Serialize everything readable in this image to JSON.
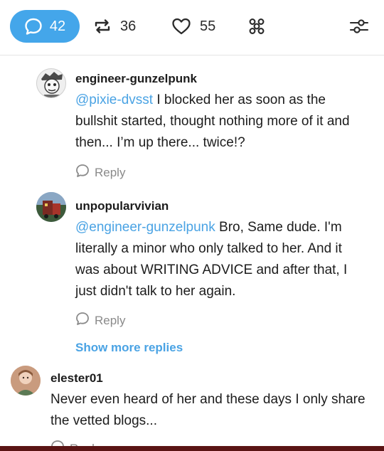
{
  "stats": {
    "comments": "42",
    "reblogs": "36",
    "likes": "55"
  },
  "icons": {
    "comments": "speech-bubble-icon",
    "reblogs": "reblog-icon",
    "likes": "heart-icon",
    "grid": "apps-icon",
    "filter": "sliders-icon",
    "reply": "speech-bubble-icon"
  },
  "colors": {
    "accent": "#44a6ea",
    "mention": "#4aa3e4"
  },
  "comments": [
    {
      "username": "engineer-gunzelpunk",
      "mention": "@pixie-dvsst",
      "text": " I blocked her as soon as the bullshit started, thought nothing more of it and then... I’m up there... twice!?",
      "reply_label": "Reply"
    },
    {
      "username": "unpopularvivian",
      "mention": "@engineer-gunzelpunk",
      "text": " Bro, Same dude. I'm literally a minor who only talked to her. And it was about WRITING ADVICE and after that, I just didn't talk to her again.",
      "reply_label": "Reply"
    },
    {
      "username": "elester01",
      "mention": "",
      "text": "Never even heard of her and these days I only share the vetted blogs...",
      "reply_label": "Reply"
    }
  ],
  "show_more_label": "Show more replies"
}
